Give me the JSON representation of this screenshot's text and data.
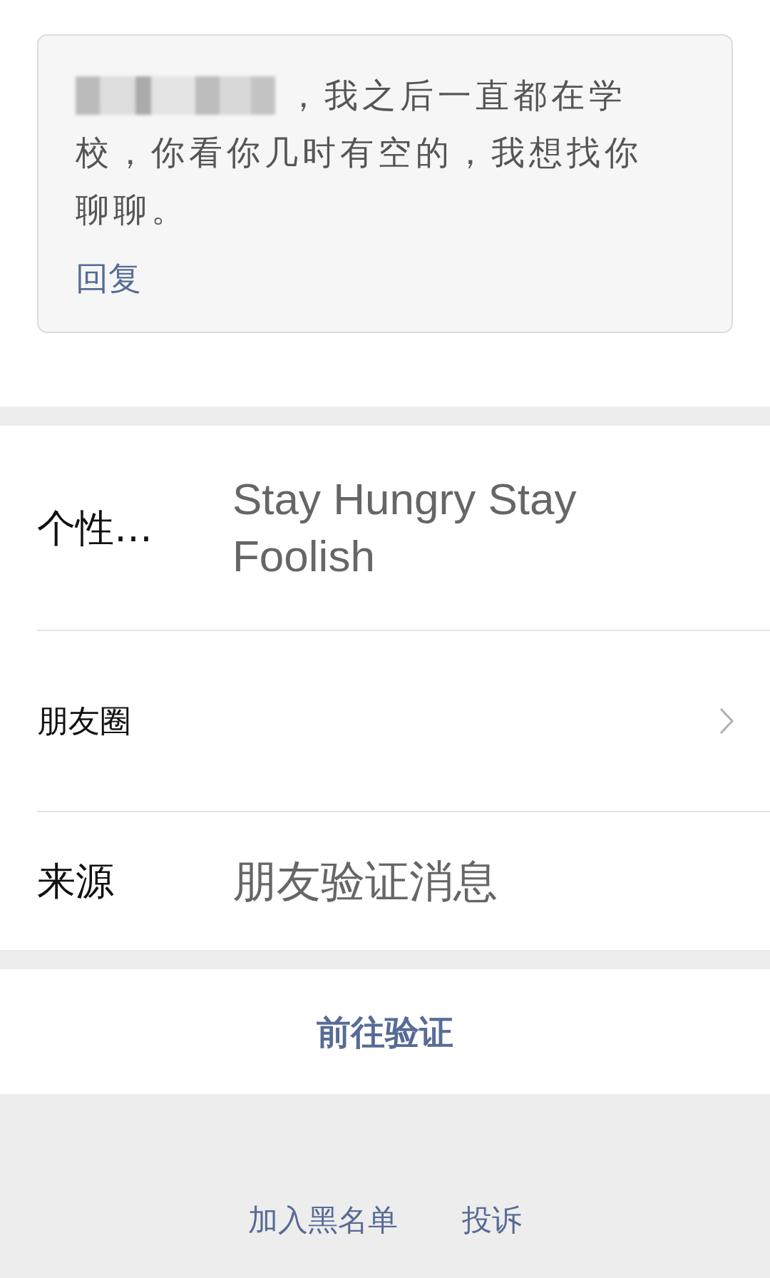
{
  "message_card": {
    "lines": [
      "，我之后一直都在学",
      "校，你看你几时有空的，我想找你",
      "聊聊。"
    ],
    "reply_link": "回复"
  },
  "info_rows": [
    {
      "kind": "text",
      "label": "个性…",
      "value": "Stay Hungry Stay Foolish"
    },
    {
      "kind": "link",
      "label": "朋友圈"
    },
    {
      "kind": "text",
      "label": "来源",
      "value": "朋友验证消息"
    }
  ],
  "verify_button": "前往验证",
  "footer_links": [
    "加入黑名单",
    "投诉"
  ]
}
